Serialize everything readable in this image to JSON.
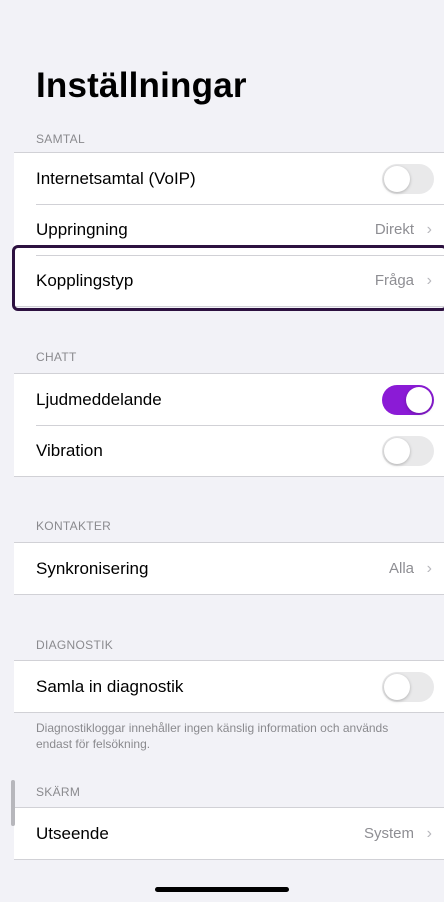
{
  "header": {
    "title": "Inställningar"
  },
  "sections": {
    "samtal": {
      "header": "SAMTAL",
      "voip_label": "Internetsamtal (VoIP)",
      "voip_on": false,
      "uppringning_label": "Uppringning",
      "uppringning_value": "Direkt",
      "koppling_label": "Kopplingstyp",
      "koppling_value": "Fråga"
    },
    "chatt": {
      "header": "CHATT",
      "ljud_label": "Ljudmeddelande",
      "ljud_on": true,
      "vibration_label": "Vibration",
      "vibration_on": false
    },
    "kontakter": {
      "header": "KONTAKTER",
      "synk_label": "Synkronisering",
      "synk_value": "Alla"
    },
    "diagnostik": {
      "header": "DIAGNOSTIK",
      "samla_label": "Samla in diagnostik",
      "samla_on": false,
      "footnote": "Diagnostikloggar innehåller ingen känslig information och används endast för felsökning."
    },
    "skarm": {
      "header": "SKÄRM",
      "utseende_label": "Utseende",
      "utseende_value": "System"
    }
  },
  "icons": {
    "chevron": "›",
    "chevron_name": "chevron-right-icon"
  },
  "colors": {
    "accent": "#8b1bd6",
    "background": "#f2f2f7",
    "highlight_border": "#2d1140",
    "secondary_text": "#8e8e93"
  }
}
